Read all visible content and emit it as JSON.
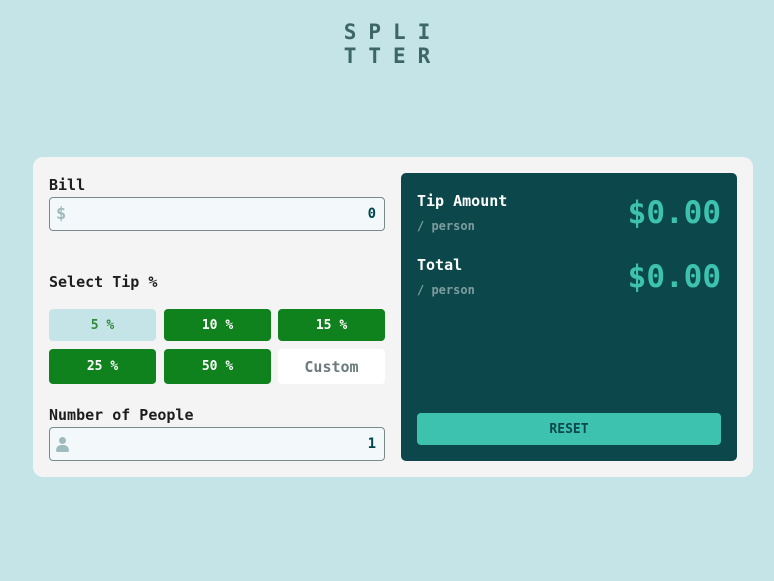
{
  "logo": {
    "line1": "SPLI",
    "line2": "TTER"
  },
  "bill": {
    "label": "Bill",
    "currency_icon": "dollar-icon",
    "symbol": "$",
    "value": "0"
  },
  "tip": {
    "label": "Select Tip %",
    "options": [
      "5 %",
      "10 %",
      "15 %",
      "25 %",
      "50 %"
    ],
    "custom_placeholder": "Custom",
    "selected": "5 %"
  },
  "people": {
    "label": "Number of People",
    "icon": "person-icon",
    "value": "1"
  },
  "results": {
    "tip_amount": {
      "title": "Tip Amount",
      "sub": "/ person",
      "value": "$0.00"
    },
    "total": {
      "title": "Total",
      "sub": "/ person",
      "value": "$0.00"
    },
    "reset_label": "RESET"
  },
  "colors": {
    "background": "#c5e4e7",
    "panel": "#0b474b",
    "accent": "#3dc2af",
    "tip_button": "#0f821d",
    "card": "#f4f4f4"
  }
}
